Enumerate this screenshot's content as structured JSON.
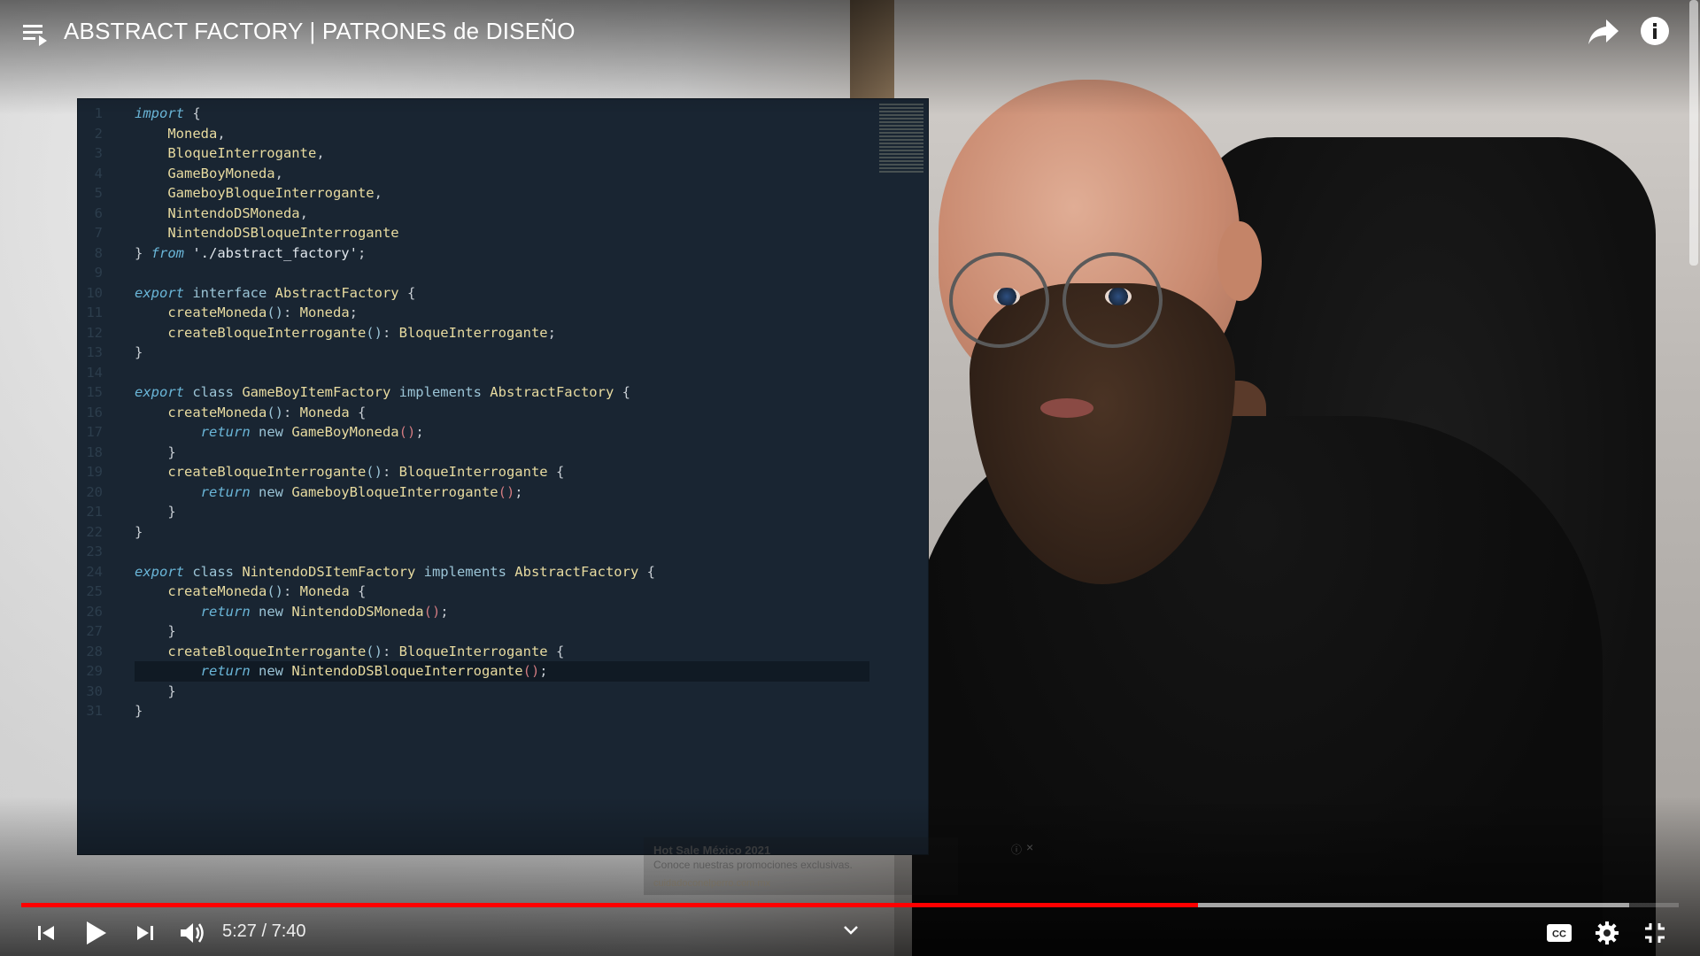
{
  "video": {
    "title": "ABSTRACT FACTORY | PATRONES de DISEÑO",
    "current_time": "5:27",
    "separator": " / ",
    "duration": "7:40",
    "progress_played": 0.71,
    "progress_buffered": 0.97
  },
  "icons": {
    "playlist": "playlist-icon",
    "share": "share-icon",
    "info": "info-icon",
    "previous": "skip-previous-icon",
    "play": "play-icon",
    "next": "skip-next-icon",
    "volume": "volume-icon",
    "more": "chevron-down-icon",
    "captions": "cc-icon",
    "settings": "gear-icon",
    "fullscreen_exit": "fullscreen-exit-icon"
  },
  "ad": {
    "title": "Hot Sale México 2021",
    "description": "Conoce nuestras promociones exclusivas.",
    "url": "cuidadoconelperro.com.mx",
    "info": "ⓘ",
    "close": "×"
  },
  "code": {
    "lines": [
      [
        [
          "kw",
          "import"
        ],
        [
          "pn",
          " {"
        ]
      ],
      [
        [
          "id",
          "    Moneda"
        ],
        [
          "pn",
          ","
        ]
      ],
      [
        [
          "id",
          "    BloqueInterrogante"
        ],
        [
          "pn",
          ","
        ]
      ],
      [
        [
          "id",
          "    GameBoyMoneda"
        ],
        [
          "pn",
          ","
        ]
      ],
      [
        [
          "id",
          "    GameboyBloqueInterrogante"
        ],
        [
          "pn",
          ","
        ]
      ],
      [
        [
          "id",
          "    NintendoDSMoneda"
        ],
        [
          "pn",
          ","
        ]
      ],
      [
        [
          "id",
          "    NintendoDSBloqueInterrogante"
        ]
      ],
      [
        [
          "pn",
          "} "
        ],
        [
          "kw",
          "from"
        ],
        [
          "str",
          " './abstract_factory'"
        ],
        [
          "pn",
          ";"
        ]
      ],
      [],
      [
        [
          "kw",
          "export"
        ],
        [
          "st",
          " interface"
        ],
        [
          "id",
          " AbstractFactory"
        ],
        [
          "pn",
          " {"
        ]
      ],
      [
        [
          "id",
          "    createMoneda"
        ],
        [
          "st",
          "()"
        ],
        [
          "pn",
          ": "
        ],
        [
          "id",
          "Moneda"
        ],
        [
          "pn",
          ";"
        ]
      ],
      [
        [
          "id",
          "    createBloqueInterrogante"
        ],
        [
          "st",
          "()"
        ],
        [
          "pn",
          ": "
        ],
        [
          "id",
          "BloqueInterrogante"
        ],
        [
          "pn",
          ";"
        ]
      ],
      [
        [
          "pn",
          "}"
        ]
      ],
      [],
      [
        [
          "kw",
          "export"
        ],
        [
          "st",
          " class"
        ],
        [
          "id",
          " GameBoyItemFactory"
        ],
        [
          "st",
          " implements"
        ],
        [
          "id",
          " AbstractFactory"
        ],
        [
          "pn",
          " {"
        ]
      ],
      [
        [
          "id",
          "    createMoneda"
        ],
        [
          "st",
          "()"
        ],
        [
          "pn",
          ": "
        ],
        [
          "id",
          "Moneda"
        ],
        [
          "pn",
          " {"
        ]
      ],
      [
        [
          "kw",
          "        return"
        ],
        [
          "st",
          " new"
        ],
        [
          "id",
          " GameBoyMoneda"
        ],
        [
          "br",
          "()"
        ],
        [
          "pn",
          ";"
        ]
      ],
      [
        [
          "pn",
          "    }"
        ]
      ],
      [
        [
          "id",
          "    createBloqueInterrogante"
        ],
        [
          "st",
          "()"
        ],
        [
          "pn",
          ": "
        ],
        [
          "id",
          "BloqueInterrogante"
        ],
        [
          "pn",
          " {"
        ]
      ],
      [
        [
          "kw",
          "        return"
        ],
        [
          "st",
          " new"
        ],
        [
          "id",
          " GameboyBloqueInterrogante"
        ],
        [
          "br",
          "()"
        ],
        [
          "pn",
          ";"
        ]
      ],
      [
        [
          "pn",
          "    }"
        ]
      ],
      [
        [
          "pn",
          "}"
        ]
      ],
      [],
      [
        [
          "kw",
          "export"
        ],
        [
          "st",
          " class"
        ],
        [
          "id",
          " NintendoDSItemFactory"
        ],
        [
          "st",
          " implements"
        ],
        [
          "id",
          " AbstractFactory"
        ],
        [
          "pn",
          " {"
        ]
      ],
      [
        [
          "id",
          "    createMoneda"
        ],
        [
          "st",
          "()"
        ],
        [
          "pn",
          ": "
        ],
        [
          "id",
          "Moneda"
        ],
        [
          "pn",
          " {"
        ]
      ],
      [
        [
          "kw",
          "        return"
        ],
        [
          "st",
          " new"
        ],
        [
          "id",
          " NintendoDSMoneda"
        ],
        [
          "br",
          "()"
        ],
        [
          "pn",
          ";"
        ]
      ],
      [
        [
          "pn",
          "    }"
        ]
      ],
      [
        [
          "id",
          "    createBloqueInterrogante"
        ],
        [
          "st",
          "()"
        ],
        [
          "pn",
          ": "
        ],
        [
          "id",
          "BloqueInterrogante"
        ],
        [
          "pn",
          " {"
        ]
      ],
      [
        [
          "kw",
          "        return"
        ],
        [
          "st",
          " new"
        ],
        [
          "id",
          " NintendoDSBloqueInterrogante"
        ],
        [
          "br",
          "()"
        ],
        [
          "pn",
          ";"
        ]
      ],
      [
        [
          "pn",
          "    }"
        ]
      ],
      [
        [
          "pn",
          "}"
        ]
      ]
    ],
    "active_line": 29,
    "line_numbers": [
      "1",
      "2",
      "3",
      "4",
      "5",
      "6",
      "7",
      "8",
      "9",
      "10",
      "11",
      "12",
      "13",
      "14",
      "15",
      "16",
      "17",
      "18",
      "19",
      "20",
      "21",
      "22",
      "23",
      "24",
      "25",
      "26",
      "27",
      "28",
      "29",
      "30",
      "31"
    ]
  },
  "colors": {
    "progress_played": "#ff0000",
    "editor_bg": "#192532"
  }
}
